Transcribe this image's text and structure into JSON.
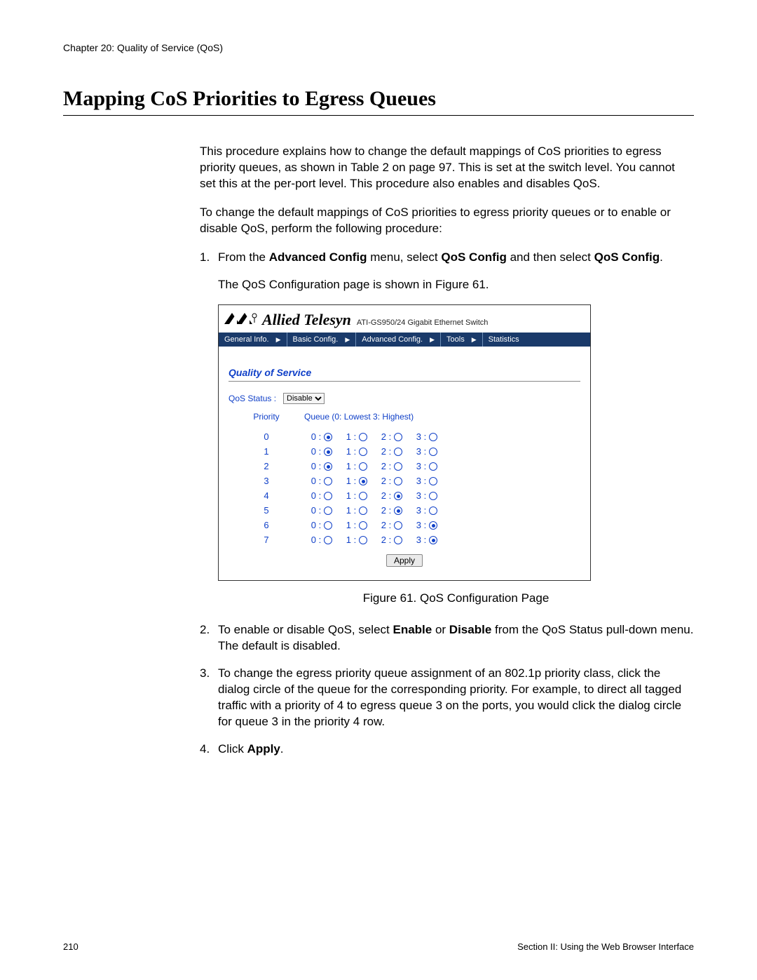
{
  "chapter_header": "Chapter 20: Quality of Service (QoS)",
  "title": "Mapping CoS Priorities to Egress Queues",
  "intro_p1": "This procedure explains how to change the default mappings of CoS priorities to egress priority queues, as shown in Table 2 on page 97. This is set at the switch level. You cannot set this at the per-port level. This procedure also enables and disables QoS.",
  "intro_p2": "To change the default mappings of CoS priorities to egress priority queues or to enable or disable QoS, perform the following procedure:",
  "steps": {
    "s1_num": "1.",
    "s1_a": "From the ",
    "s1_b": "Advanced Config",
    "s1_c": " menu, select ",
    "s1_d": "QoS Config",
    "s1_e": " and then select ",
    "s1_f": "QoS Config",
    "s1_g": ".",
    "s1_sub": "The QoS Configuration page is shown in Figure 61.",
    "s2_num": "2.",
    "s2_a": "To enable or disable QoS, select ",
    "s2_b": "Enable",
    "s2_c": " or ",
    "s2_d": "Disable",
    "s2_e": " from the QoS Status pull-down menu. The default is disabled.",
    "s3_num": "3.",
    "s3": "To change the egress priority queue assignment of an 802.1p priority class, click the dialog circle of the queue for the corresponding priority. For example, to direct all tagged traffic with a priority of 4 to egress queue 3 on the ports, you would click the dialog circle for queue 3 in the priority 4 row.",
    "s4_num": "4.",
    "s4_a": "Click ",
    "s4_b": "Apply",
    "s4_c": "."
  },
  "figure": {
    "brand_name": "Allied Telesyn",
    "product": "ATI-GS950/24 Gigabit Ethernet Switch",
    "nav": [
      "General Info.",
      "Basic Config.",
      "Advanced Config.",
      "Tools",
      "Statistics"
    ],
    "module_title": "Quality of Service",
    "status_label": "QoS Status :",
    "status_value": "Disable",
    "col_priority": "Priority",
    "col_queue": "Queue  (0: Lowest  3: Highest)",
    "queue_labels": [
      "0 :",
      "1 :",
      "2 :",
      "3 :"
    ],
    "rows": [
      {
        "priority": "0",
        "selected": 0
      },
      {
        "priority": "1",
        "selected": 0
      },
      {
        "priority": "2",
        "selected": 0
      },
      {
        "priority": "3",
        "selected": 1
      },
      {
        "priority": "4",
        "selected": 2
      },
      {
        "priority": "5",
        "selected": 2
      },
      {
        "priority": "6",
        "selected": 3
      },
      {
        "priority": "7",
        "selected": 3
      }
    ],
    "apply": "Apply",
    "caption": "Figure 61. QoS Configuration Page"
  },
  "footer": {
    "page": "210",
    "section": "Section II: Using the Web Browser Interface"
  }
}
